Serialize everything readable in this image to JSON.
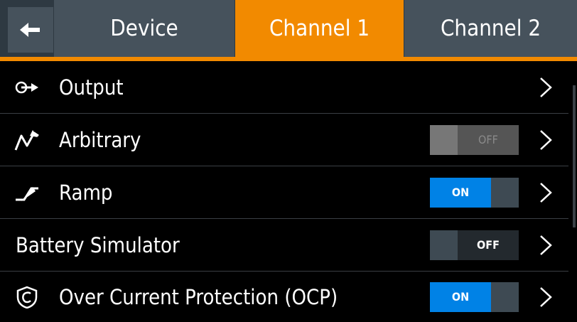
{
  "tabs": {
    "back_icon": "arrow-left-icon",
    "items": [
      {
        "label": "Device",
        "active": false
      },
      {
        "label": "Channel 1",
        "active": true
      },
      {
        "label": "Channel 2",
        "active": false
      }
    ]
  },
  "rows": [
    {
      "label": "Output",
      "icon": "output-arrow-icon",
      "toggle": null
    },
    {
      "label": "Arbitrary",
      "icon": "arbitrary-wave-icon",
      "toggle": {
        "state": "OFF",
        "disabled": true
      }
    },
    {
      "label": "Ramp",
      "icon": "ramp-icon",
      "toggle": {
        "state": "ON",
        "disabled": false
      }
    },
    {
      "label": "Battery Simulator",
      "icon": null,
      "toggle": {
        "state": "OFF",
        "disabled": false
      }
    },
    {
      "label": "Over Current Protection (OCP)",
      "icon": "shield-c-icon",
      "toggle": {
        "state": "ON",
        "disabled": false
      }
    }
  ],
  "colors": {
    "accent": "#f28a00",
    "toggle_on": "#0082e6",
    "tab_bg": "#46525c"
  }
}
